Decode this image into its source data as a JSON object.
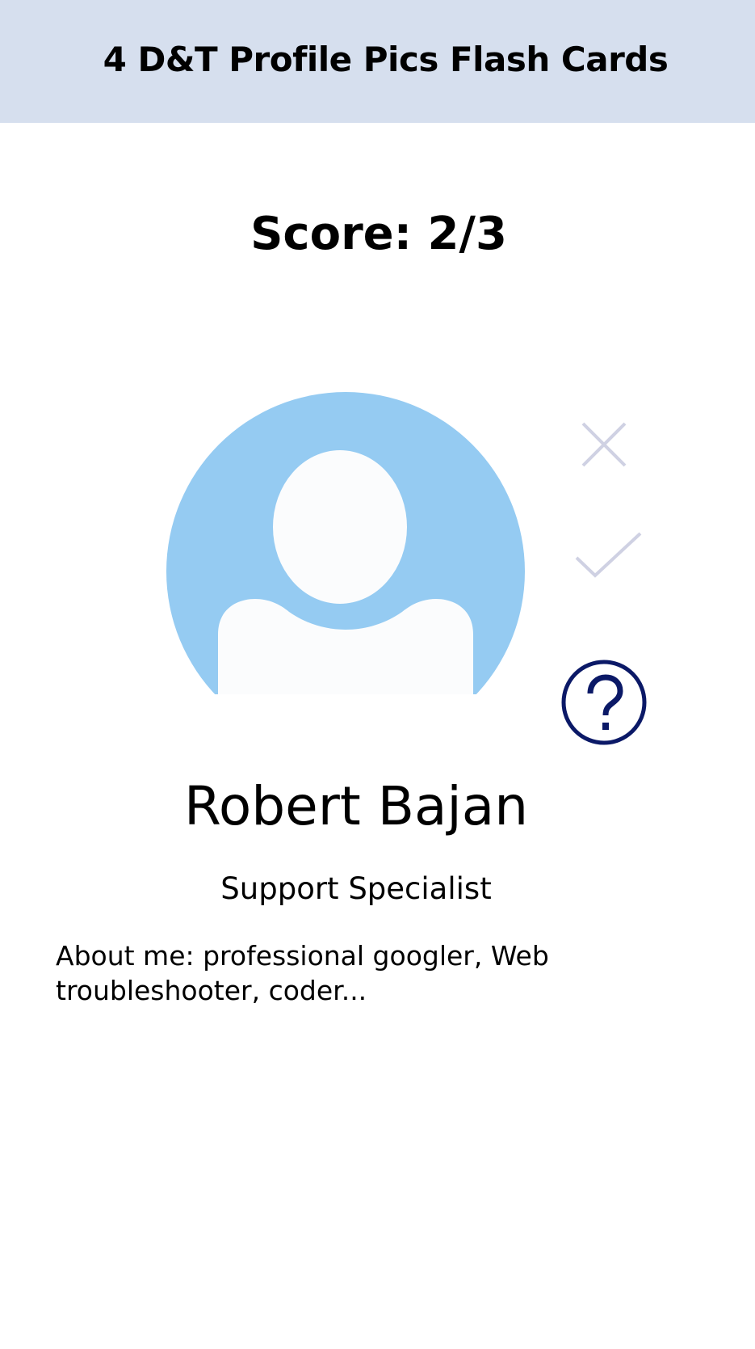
{
  "header": {
    "title": "4 D&T Profile Pics Flash Cards"
  },
  "score": {
    "text": "Score: 2/3"
  },
  "card": {
    "avatar_icon": "person-placeholder-icon",
    "name": "Robert Bajan",
    "job_title": "Support Specialist",
    "about": "About me: professional googler, Web troubleshooter, coder..."
  },
  "actions": {
    "wrong_icon": "close-icon",
    "correct_icon": "checkmark-icon",
    "hint_icon": "question-mark-icon"
  },
  "colors": {
    "header_background": "#d6dfee",
    "avatar_background": "#95cbf2",
    "avatar_figure": "#fbfcfd",
    "action_icon_muted": "#cfd1e3",
    "help_icon": "#0b1967"
  }
}
